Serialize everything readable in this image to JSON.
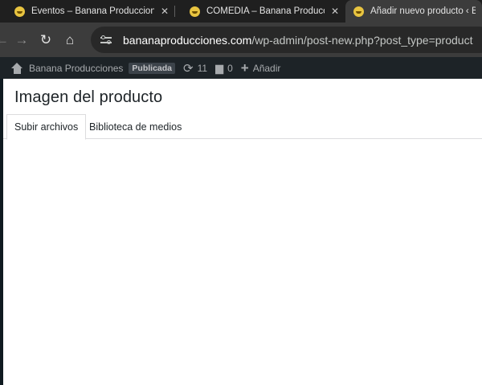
{
  "browser": {
    "tabs": [
      {
        "title": "Eventos – Banana Producciones",
        "close": "✕"
      },
      {
        "title": "COMEDIA – Banana Produccion",
        "close": "✕"
      },
      {
        "title": "Añadir nuevo producto ‹ Banana"
      }
    ],
    "toolbar": {
      "back": "←",
      "forward": "→",
      "reload": "↻",
      "home": "⌂"
    },
    "url": {
      "host": "bananaproducciones.com",
      "path": "/wp-admin/post-new.php?post_type=product"
    }
  },
  "adminbar": {
    "site_name": "Banana Producciones",
    "badge": "Publicada",
    "updates_count": "11",
    "comments_count": "0",
    "new_label": "Añadir"
  },
  "modal": {
    "title": "Imagen del producto",
    "tabs": [
      "Subir archivos",
      "Biblioteca de medios"
    ]
  },
  "colors": {
    "adminbar_bg": "#1d2327",
    "favicon": "#e8c440"
  }
}
